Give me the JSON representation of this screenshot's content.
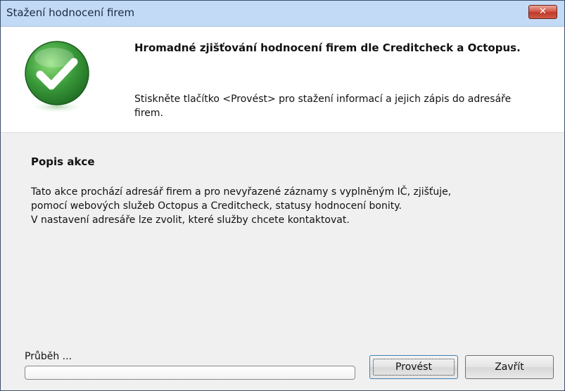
{
  "window": {
    "title": "Stažení hodnocení firem",
    "close_label": "✕"
  },
  "header": {
    "icon": "checkmark-icon",
    "title": "Hromadné zjišťování hodnocení firem dle Creditcheck a Octopus.",
    "description": "Stiskněte tlačítko <Provést> pro stažení informací a jejich zápis do adresáře firem."
  },
  "content": {
    "section_title": "Popis akce",
    "description_lines": [
      "Tato akce prochází adresář firem a pro nevyřazené záznamy s vyplněným IČ, zjišťuje,",
      "pomocí webových služeb Octopus a Creditcheck, statusy hodnocení bonity.",
      "V nastavení adresáře lze zvolit, které služby chcete kontaktovat."
    ]
  },
  "progress": {
    "label": "Průběh ...",
    "value": 0
  },
  "buttons": {
    "execute": "Provést",
    "close": "Zavřít"
  },
  "colors": {
    "titlebar": "#c3daf6",
    "close_button": "#c0392b",
    "check_green": "#3a9a3a"
  }
}
